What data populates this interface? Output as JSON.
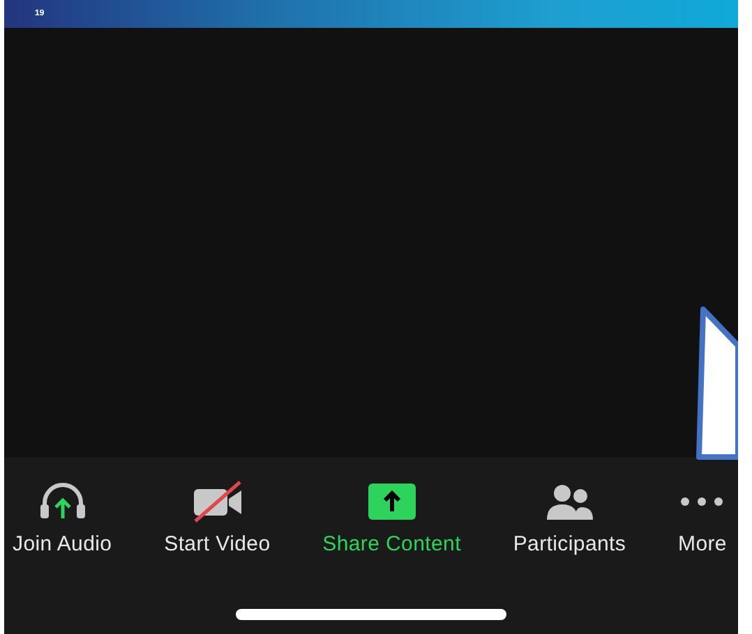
{
  "banner": {
    "page_number": "19"
  },
  "toolbar": [
    {
      "kind": "audio",
      "label": "Join Audio",
      "selected": false
    },
    {
      "kind": "video",
      "label": "Start Video",
      "selected": false
    },
    {
      "kind": "share",
      "label": "Share Content",
      "selected": true
    },
    {
      "kind": "participants",
      "label": "Participants",
      "selected": false
    },
    {
      "kind": "more",
      "label": "More",
      "selected": false
    }
  ]
}
